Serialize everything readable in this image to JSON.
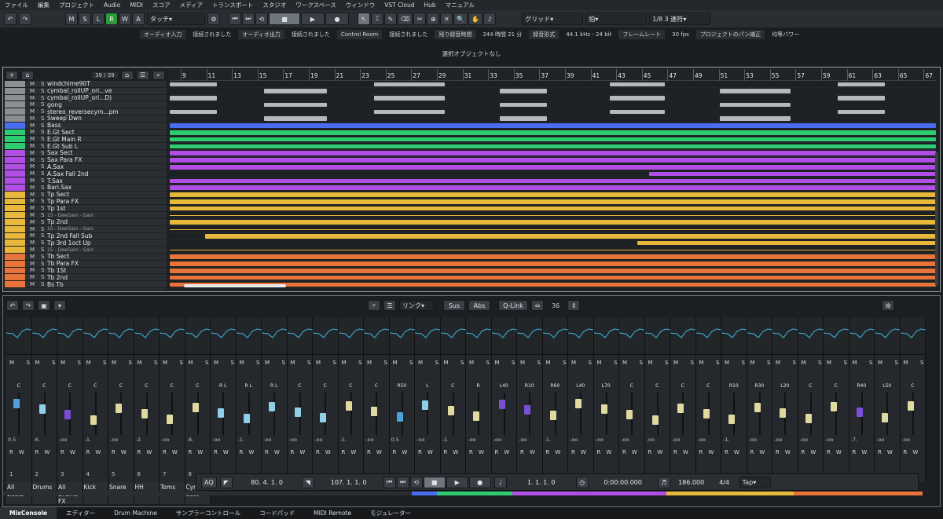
{
  "menu": [
    "ファイル",
    "編集",
    "プロジェクト",
    "Audio",
    "MIDI",
    "スコア",
    "メディア",
    "トランスポート",
    "スタジオ",
    "ワークスペース",
    "ウィンドウ",
    "VST Cloud",
    "Hub",
    "マニュアル"
  ],
  "toolbar": {
    "modes": [
      "M",
      "S",
      "L",
      "R",
      "W",
      "A"
    ],
    "touch": "タッチ",
    "grid": "グリッド",
    "beat": "拍",
    "quantize": "1/8 3 連符"
  },
  "status": [
    {
      "label": "オーディオ入力",
      "value": "接続されました"
    },
    {
      "label": "オーディオ出力",
      "value": "接続されました"
    },
    {
      "label": "Control Room",
      "value": "接続されました"
    },
    {
      "label": "残り録音時間",
      "value": "244 時間 21 分"
    },
    {
      "label": "録音形式",
      "value": "44.1 kHz - 24 bit"
    },
    {
      "label": "フレームレート",
      "value": "30 fps"
    },
    {
      "label": "プロジェクトのパン補正",
      "value": "均等パワー"
    }
  ],
  "info": "選択オブジェクトなし",
  "track_count": "39 / 39",
  "ruler": [
    "9",
    "11",
    "13",
    "15",
    "17",
    "19",
    "21",
    "23",
    "25",
    "27",
    "29",
    "31",
    "33",
    "35",
    "37",
    "39",
    "41",
    "43",
    "45",
    "47",
    "49",
    "51",
    "53",
    "55",
    "57",
    "59",
    "61",
    "63",
    "65",
    "67"
  ],
  "tracks": [
    {
      "name": "windchime90T",
      "color": "#8a8f94"
    },
    {
      "name": "cymbal_rollUP_ori...ve",
      "color": "#8a8f94"
    },
    {
      "name": "cymbal_rollUP_ori...D)",
      "color": "#8a8f94"
    },
    {
      "name": "gong",
      "color": "#8a8f94"
    },
    {
      "name": "stereo_reversecym...pm",
      "color": "#8a8f94"
    },
    {
      "name": "Sweep Dwn",
      "color": "#8a8f94"
    },
    {
      "name": "Bass",
      "color": "#4a6cf0"
    },
    {
      "name": "E.Gt Sect",
      "color": "#2ecc71"
    },
    {
      "name": "E.Gt Main R",
      "color": "#2ecc71"
    },
    {
      "name": "E.Gt Sub L",
      "color": "#2ecc71"
    },
    {
      "name": "Sax Sect",
      "color": "#b04ee6"
    },
    {
      "name": "Sax Para FX",
      "color": "#b04ee6"
    },
    {
      "name": "A.Sax",
      "color": "#b04ee6"
    },
    {
      "name": "A.Sax Fall 2nd",
      "color": "#b04ee6"
    },
    {
      "name": "T.Sax",
      "color": "#b04ee6"
    },
    {
      "name": "Bari.Sax",
      "color": "#b04ee6"
    },
    {
      "name": "Tp Sect",
      "color": "#e8b83a"
    },
    {
      "name": "Tp Para FX",
      "color": "#e8b83a"
    },
    {
      "name": "Tp 1st",
      "color": "#e8b83a"
    },
    {
      "name": "15 - DeeGain - Gain",
      "color": "#e8b83a"
    },
    {
      "name": "Tp 2nd",
      "color": "#e8b83a"
    },
    {
      "name": "15 - DeeGain - Gain",
      "color": "#e8b83a"
    },
    {
      "name": "Tp 2nd Fall Sub",
      "color": "#e8b83a"
    },
    {
      "name": "Tp 3rd 1oct Up",
      "color": "#e8b83a"
    },
    {
      "name": "15 - DeeGain - Gain",
      "color": "#e8b83a"
    },
    {
      "name": "Tb Sect",
      "color": "#e8743a"
    },
    {
      "name": "Tb Para FX",
      "color": "#e8743a"
    },
    {
      "name": "Tb 1St",
      "color": "#e8743a"
    },
    {
      "name": "Tb 2nd",
      "color": "#e8743a"
    },
    {
      "name": "Bs Tb",
      "color": "#e8743a"
    }
  ],
  "mixer": {
    "zoom": "36",
    "link": "リンク",
    "sus": "Sus",
    "abs": "Abs",
    "qlink": "Q-Link",
    "pans": [
      "C",
      "C",
      "C",
      "C",
      "C",
      "C",
      "C",
      "C",
      "R L",
      "R L",
      "R L",
      "C",
      "C",
      "C",
      "C",
      "R50",
      "L",
      "C",
      "R",
      "L40",
      "R10",
      "R60",
      "L40",
      "L70",
      "C",
      "C",
      "C",
      "C",
      "R10",
      "R30",
      "L20",
      "C",
      "C",
      "R40",
      "L50",
      "C"
    ],
    "values": [
      "0.5",
      "-6.",
      "-oo",
      "-1.",
      "-oo",
      "-2.",
      "-oo",
      "-8.",
      "-oo",
      "-1.",
      "-oo",
      "-oo",
      "-oo",
      "-1.",
      "-oo",
      "0.5",
      "-oo",
      "-1.",
      "-oo",
      "-oo",
      "-oo",
      "-1.",
      "-oo",
      "-oo",
      "-oo",
      "-oo",
      "-oo",
      "-oo",
      "-1.",
      "-oo",
      "-oo",
      "-oo",
      "-oo",
      "-7.",
      "-oo",
      "-oo"
    ],
    "numbers": [
      "1",
      "2",
      "3",
      "4",
      "5",
      "6",
      "7",
      "8"
    ],
    "names": [
      "All Beats",
      "Drums",
      "All Drums FX",
      "Kick",
      "Snare",
      "HH",
      "Toms",
      "Cym Sect"
    ]
  },
  "transport": {
    "left": "80. 4. 1. 0",
    "right": "107. 1. 1. 0",
    "pos": "1. 1. 1. 0",
    "time": "0:00:00.000",
    "tempo": "186.000",
    "sig": "4/4",
    "tap": "Tap"
  },
  "tabs": [
    "MixConsole",
    "エディター",
    "Drum Machine",
    "サンプラーコントロール",
    "コードパッド",
    "MIDI Remote",
    "モジュレーター"
  ]
}
